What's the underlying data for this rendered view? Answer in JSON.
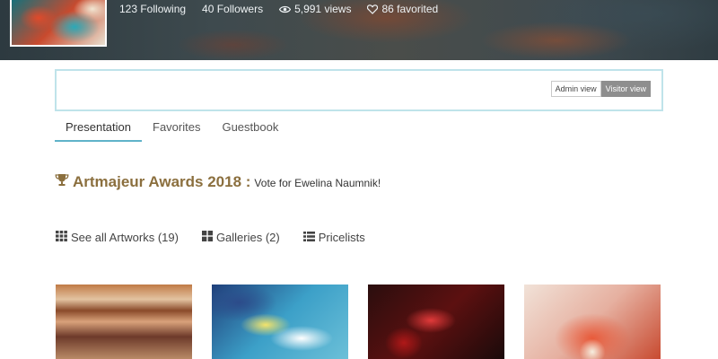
{
  "profile": {
    "stats": {
      "following": "123 Following",
      "followers": "40 Followers",
      "views": "5,991 views",
      "favorited": "86 favorited"
    }
  },
  "view_toggle": {
    "admin_label": "Admin view",
    "visitor_label": "Visitor view",
    "active": "visitor"
  },
  "tabs": [
    {
      "label": "Presentation",
      "active": true
    },
    {
      "label": "Favorites",
      "active": false
    },
    {
      "label": "Guestbook",
      "active": false
    }
  ],
  "awards": {
    "icon": "trophy-icon",
    "title": "Artmajeur Awards 2018 :",
    "subtitle": "Vote for Ewelina Naumnik!"
  },
  "links": [
    {
      "icon": "grid-icon",
      "label": "See all Artworks (19)"
    },
    {
      "icon": "gallery-icon",
      "label": "Galleries (2)"
    },
    {
      "icon": "list-icon",
      "label": "Pricelists"
    }
  ],
  "colors": {
    "accent": "#5fb3c9",
    "awards_gold": "#8b6f3e",
    "view_box_border": "#bfe3ea"
  }
}
